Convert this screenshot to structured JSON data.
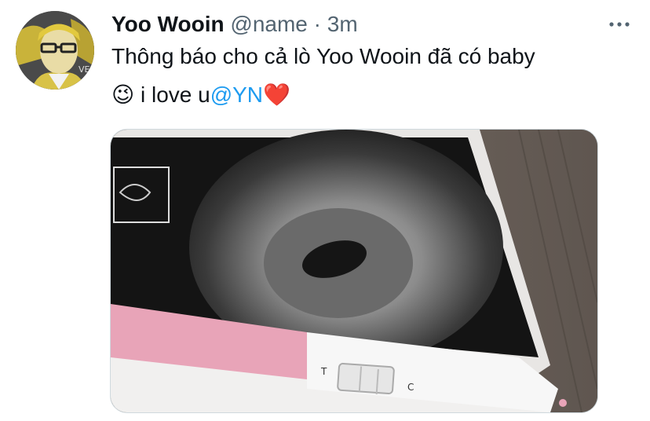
{
  "tweet": {
    "display_name": "Yoo Wooin",
    "handle": "@name",
    "separator": "·",
    "time": "3m",
    "text_line1": "Thông báo cho cả lò Yoo Wooin đã có baby",
    "wink_emoji": "😉",
    "text_prefix": " i love u",
    "mention": "@YN",
    "heart_emoji": "❤️"
  },
  "media": {
    "test_label_t": "T",
    "test_label_c": "C"
  },
  "icons": {
    "more": "more-horizontal-icon"
  },
  "colors": {
    "mention": "#1d9bf0",
    "secondary_text": "#536471",
    "test_pink": "#e8a4b8"
  }
}
